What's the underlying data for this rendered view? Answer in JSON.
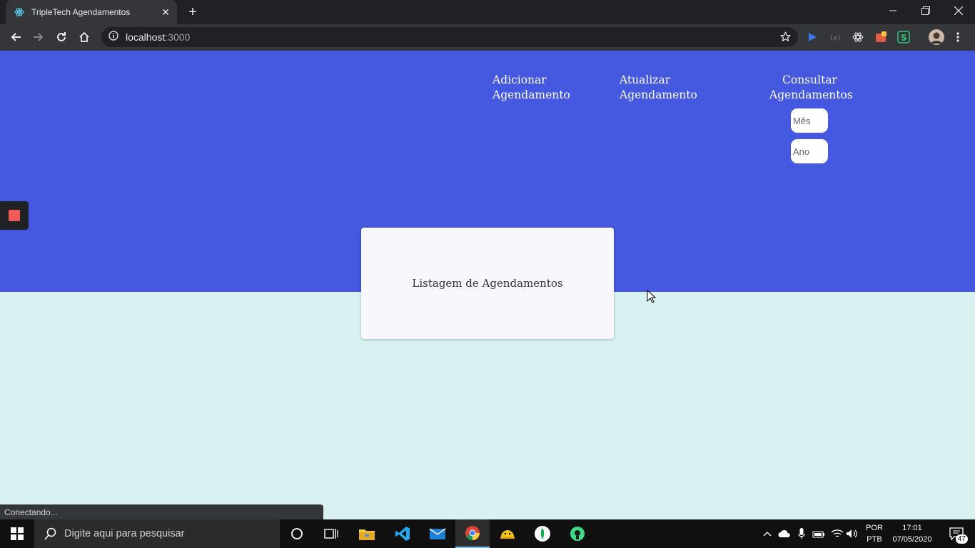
{
  "browser": {
    "tab_title": "TripleTech Agendamentos",
    "url_host": "localhost",
    "url_port": ":3000",
    "status_text": "Conectando..."
  },
  "page": {
    "nav": {
      "add": [
        "Adicionar",
        "Agendamento"
      ],
      "update": [
        "Atualizar",
        "Agendamento"
      ],
      "query": [
        "Consultar",
        "Agendamentos"
      ]
    },
    "month_placeholder": "Mês",
    "year_placeholder": "Ano",
    "card_title": "Listagem de Agendamentos",
    "colors": {
      "hero": "#4458e0",
      "background": "#d9f1f1",
      "badge": "#f05a5a"
    }
  },
  "taskbar": {
    "search_placeholder": "Digite aqui para pesquisar",
    "lang_line1": "POR",
    "lang_line2": "PTB",
    "time": "17:01",
    "date": "07/05/2020",
    "notification_count": "47"
  }
}
